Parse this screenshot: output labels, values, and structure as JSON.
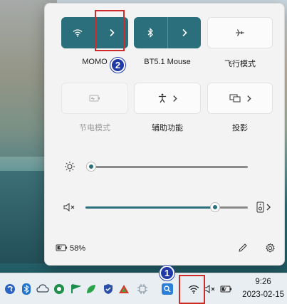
{
  "quick_settings": {
    "wifi_tile": {
      "network_name": "MOMO"
    },
    "bluetooth_tile": {
      "device_name": "BT5.1 Mouse"
    },
    "airplane_tile": {
      "label": "飞行模式"
    },
    "battery_saver_tile": {
      "label": "节电模式"
    },
    "accessibility_tile": {
      "label": "辅助功能"
    },
    "cast_tile": {
      "label": "投影"
    },
    "brightness": {
      "level_fraction": 0.0
    },
    "volume": {
      "level_fraction": 0.8,
      "muted": true
    },
    "battery": {
      "percent": "58%"
    }
  },
  "annotations": {
    "badge_1": "1",
    "badge_2": "2"
  },
  "taskbar": {
    "time": "9:26",
    "date": "2023-02-15"
  },
  "colors": {
    "accent": "#2a6f7b",
    "highlight_box": "#d12a2a",
    "badge": "#1f3aa6"
  }
}
